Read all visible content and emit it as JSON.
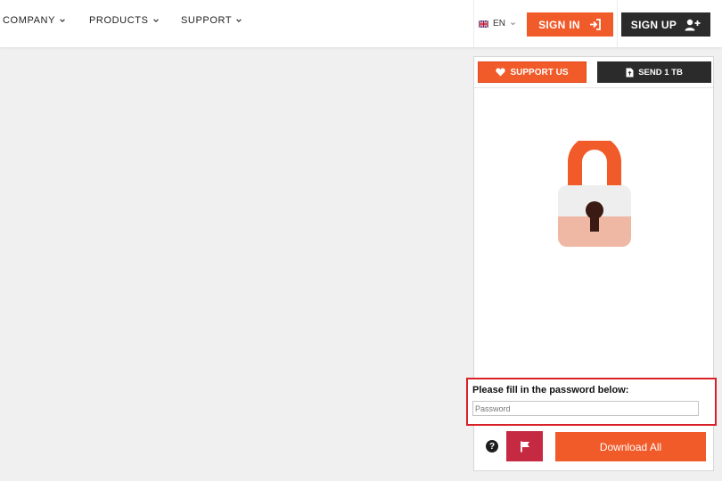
{
  "nav": {
    "company_label": "COMPANY",
    "products_label": "PRODUCTS",
    "support_label": "SUPPORT"
  },
  "language": {
    "code": "EN",
    "flag_icon": "uk-flag-icon"
  },
  "auth": {
    "signin_label": "SIGN IN",
    "signup_label": "SIGN UP"
  },
  "panel": {
    "support_label": "SUPPORT US",
    "send_label": "SEND 1 TB",
    "password_prompt": "Please fill in the password below:",
    "password_placeholder": "Password",
    "help_symbol": "?",
    "download_label": "Download All"
  },
  "colors": {
    "accent": "#f15a29",
    "dark": "#2b2b2b",
    "report": "#c62a42",
    "highlight": "#d92128",
    "lock_top": "#eeeeee",
    "lock_bottom": "#efb8a4",
    "keyhole": "#3a1a12"
  }
}
